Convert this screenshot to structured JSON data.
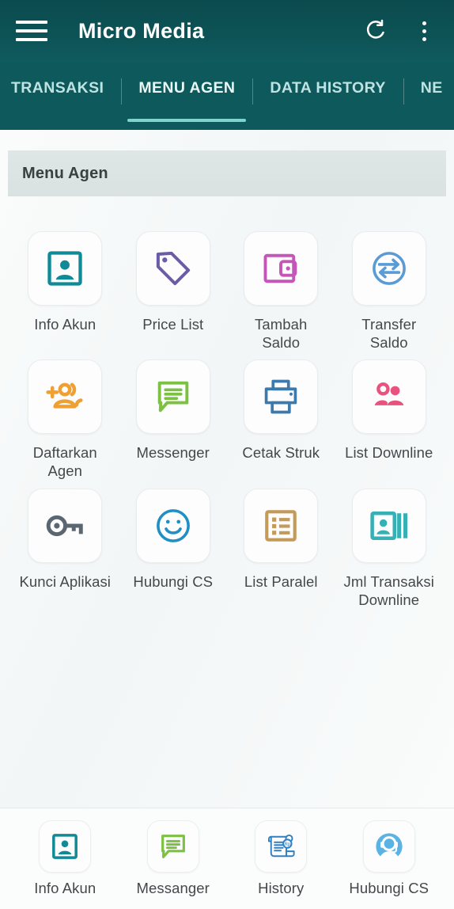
{
  "app": {
    "title": "Micro Media",
    "menu_icon": "hamburger-menu-icon",
    "refresh_icon": "refresh-icon",
    "overflow_icon": "overflow-menu-icon",
    "header_color": "#0d5356",
    "tabbar_color": "#0e595c",
    "accent_color": "#7fd3cf"
  },
  "tabs": [
    {
      "label": "TRANSAKSI",
      "active": false
    },
    {
      "label": "MENU AGEN",
      "active": true
    },
    {
      "label": "DATA HISTORY",
      "active": false
    },
    {
      "label": "NE",
      "active": false
    }
  ],
  "section": {
    "title": "Menu Agen"
  },
  "menu_items": [
    {
      "label": "Info Akun",
      "icon": "account-card-icon",
      "color": "#0f8a96"
    },
    {
      "label": "Price List",
      "icon": "price-tag-icon",
      "color": "#6c5ba8"
    },
    {
      "label": "Tambah Saldo",
      "icon": "wallet-icon",
      "color": "#c456b8"
    },
    {
      "label": "Transfer Saldo",
      "icon": "transfer-arrows-icon",
      "color": "#5b9bd5"
    },
    {
      "label": "Daftarkan Agen",
      "icon": "add-person-group-icon",
      "color": "#f0a030"
    },
    {
      "label": "Messenger",
      "icon": "chat-bubble-icon",
      "color": "#7cc142"
    },
    {
      "label": "Cetak Struk",
      "icon": "printer-icon",
      "color": "#3c79ad"
    },
    {
      "label": "List Downline",
      "icon": "people-group-icon",
      "color": "#e8527f"
    },
    {
      "label": "Kunci Aplikasi",
      "icon": "key-icon",
      "color": "#5a6670"
    },
    {
      "label": "Hubungi CS",
      "icon": "smiley-face-icon",
      "color": "#1f8fc4"
    },
    {
      "label": "List Paralel",
      "icon": "bullet-list-icon",
      "color": "#c49a5a"
    },
    {
      "label": "Jml Transaksi Downline",
      "icon": "contact-card-bars-icon",
      "color": "#35b0b5"
    }
  ],
  "bottom_nav": [
    {
      "label": "Info Akun",
      "icon": "account-card-icon",
      "color": "#0f8a96"
    },
    {
      "label": "Messanger",
      "icon": "chat-bubble-icon",
      "color": "#7cc142"
    },
    {
      "label": "History",
      "icon": "receipt-rupiah-icon",
      "color": "#2f7fc1"
    },
    {
      "label": "Hubungi CS",
      "icon": "headset-support-icon",
      "color": "#5bb3e4"
    }
  ]
}
